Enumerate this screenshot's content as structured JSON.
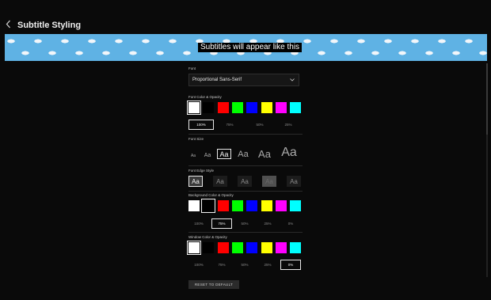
{
  "header": {
    "title": "Subtitle Styling",
    "back_icon": "chevron-left-icon"
  },
  "preview": {
    "text": "Subtitles will appear like this",
    "background_color": "#5fb2e4"
  },
  "font": {
    "label": "Font",
    "selected": "Proportional Sans-Serif",
    "icon": "chevron-down-icon"
  },
  "font_color": {
    "label": "Font Color & Opacity",
    "colors": [
      "#ffffff",
      "#000000",
      "#ff0000",
      "#00ff00",
      "#0000ff",
      "#ffff00",
      "#ff00ff",
      "#00ffff"
    ],
    "selected_color_index": 0,
    "opacity": [
      "100%",
      "75%",
      "50%",
      "25%"
    ],
    "selected_opacity_index": 0
  },
  "font_size": {
    "label": "Font Size",
    "options": [
      "Aa",
      "Aa",
      "Aa",
      "Aa",
      "Aa",
      "Aa"
    ],
    "selected_index": 2
  },
  "edge_style": {
    "label": "Font Edge Style",
    "options": [
      "Aa",
      "Aa",
      "Aa",
      "Aa",
      "Aa"
    ],
    "selected_index": 0
  },
  "background_color": {
    "label": "Background Color & Opacity",
    "colors": [
      "#ffffff",
      "#000000",
      "#ff0000",
      "#00ff00",
      "#0000ff",
      "#ffff00",
      "#ff00ff",
      "#00ffff"
    ],
    "selected_color_index": 1,
    "opacity": [
      "100%",
      "75%",
      "50%",
      "25%",
      "0%"
    ],
    "selected_opacity_index": 1
  },
  "window_color": {
    "label": "Window Color & Opacity",
    "colors": [
      "#ffffff",
      "#000000",
      "#ff0000",
      "#00ff00",
      "#0000ff",
      "#ffff00",
      "#ff00ff",
      "#00ffff"
    ],
    "selected_color_index": 0,
    "opacity": [
      "100%",
      "75%",
      "50%",
      "25%",
      "0%"
    ],
    "selected_opacity_index": 4
  },
  "reset": {
    "label": "RESET TO DEFAULT"
  }
}
